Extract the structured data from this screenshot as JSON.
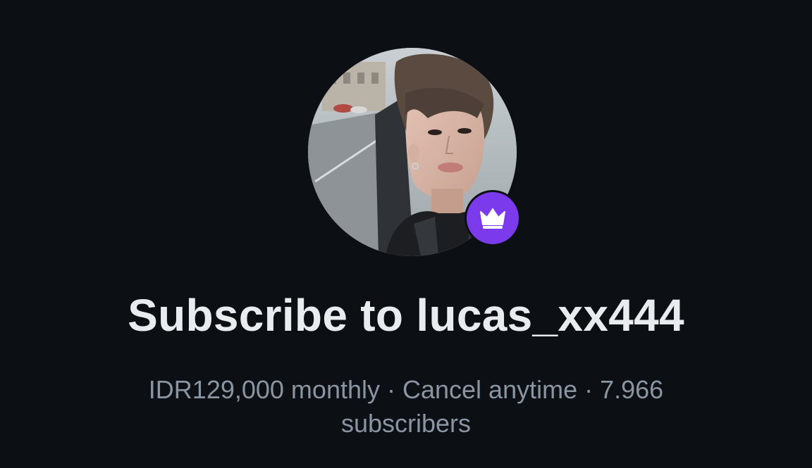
{
  "profile": {
    "avatar_alt": "Profile photo",
    "badge_icon": "crown-icon"
  },
  "heading": {
    "title": "Subscribe to lucas_xx444"
  },
  "details": {
    "price": "IDR129,000 monthly",
    "separator": " · ",
    "cancel": "Cancel anytime",
    "subscribers_count": "7.966",
    "subscribers_label": "subscribers"
  },
  "colors": {
    "background": "#0c1015",
    "accent": "#7c3aed",
    "title": "#e9ecef",
    "meta": "#8b95a1"
  }
}
